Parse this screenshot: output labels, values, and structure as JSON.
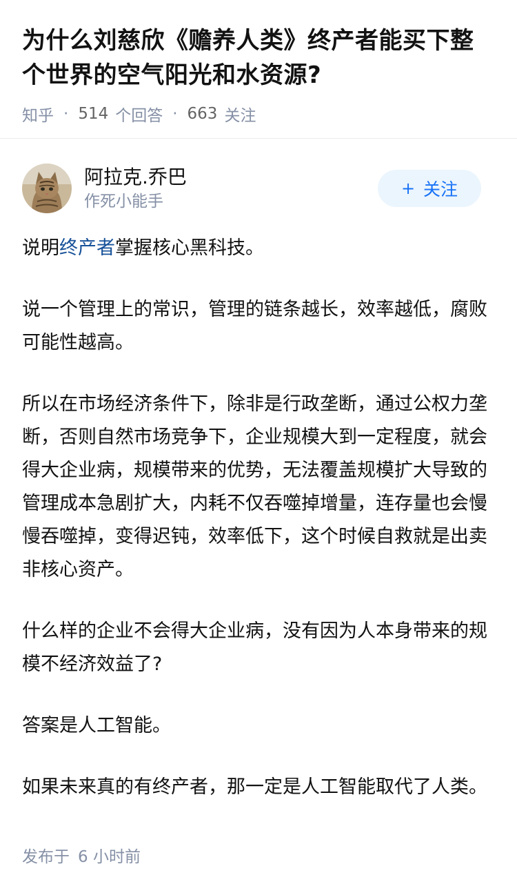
{
  "question": {
    "title": "为什么刘慈欣《赡养人类》终产者能买下整个世界的空气阳光和水资源?",
    "source": "知乎",
    "answers_count": "514",
    "answers_label": "个回答",
    "followers_count": "663",
    "followers_label": "关注"
  },
  "author": {
    "name": "阿拉克.乔巴",
    "bio": "作死小能手",
    "follow_label": "关注",
    "follow_icon": "plus-icon"
  },
  "answer": {
    "p1_before": "说明",
    "p1_link": "终产者",
    "p1_after": "掌握核心黑科技。",
    "p2": "说一个管理上的常识，管理的链条越长，效率越低，腐败可能性越高。",
    "p3": "所以在市场经济条件下，除非是行政垄断，通过公权力垄断，否则自然市场竞争下，企业规模大到一定程度，就会得大企业病，规模带来的优势，无法覆盖规模扩大导致的管理成本急剧扩大，内耗不仅吞噬掉增量，连存量也会慢慢吞噬掉，变得迟钝，效率低下，这个时候自救就是出卖非核心资产。",
    "p4": "什么样的企业不会得大企业病，没有因为人本身带来的规模不经济效益了?",
    "p5": "答案是人工智能。",
    "p6": "如果未来真的有终产者，那一定是人工智能取代了人类。"
  },
  "footer": {
    "published_label": "发布于",
    "published_time": "6 小时前"
  },
  "colors": {
    "link": "#175199",
    "accent": "#1772f6",
    "meta": "#8590a6"
  }
}
